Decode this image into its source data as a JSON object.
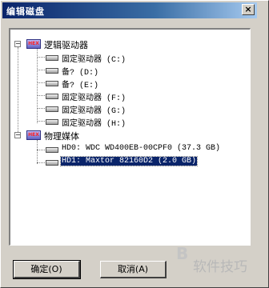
{
  "window": {
    "title": "编辑磁盘",
    "close_label": "×"
  },
  "tree": {
    "groups": [
      {
        "label": "逻辑驱动器",
        "icon": "hex-logo-icon",
        "expander": "−",
        "items": [
          {
            "label": "固定驱动器 (C:)"
          },
          {
            "label": "备? (D:)"
          },
          {
            "label": "备? (E:)"
          },
          {
            "label": "固定驱动器 (F:)"
          },
          {
            "label": "固定驱动器 (G:)"
          },
          {
            "label": "固定驱动器 (H:)"
          }
        ]
      },
      {
        "label": "物理媒体",
        "icon": "hex-logo-icon",
        "expander": "−",
        "items": [
          {
            "label": "HD0: WDC WD400EB-00CPF0 (37.3 GB)"
          },
          {
            "label": "HD1: Maxtor 82160D2 (2.0 GB)",
            "selected": true
          }
        ]
      }
    ]
  },
  "buttons": {
    "ok": "确定(O)",
    "cancel": "取消(A)"
  },
  "watermark": {
    "text": "软件技巧"
  }
}
